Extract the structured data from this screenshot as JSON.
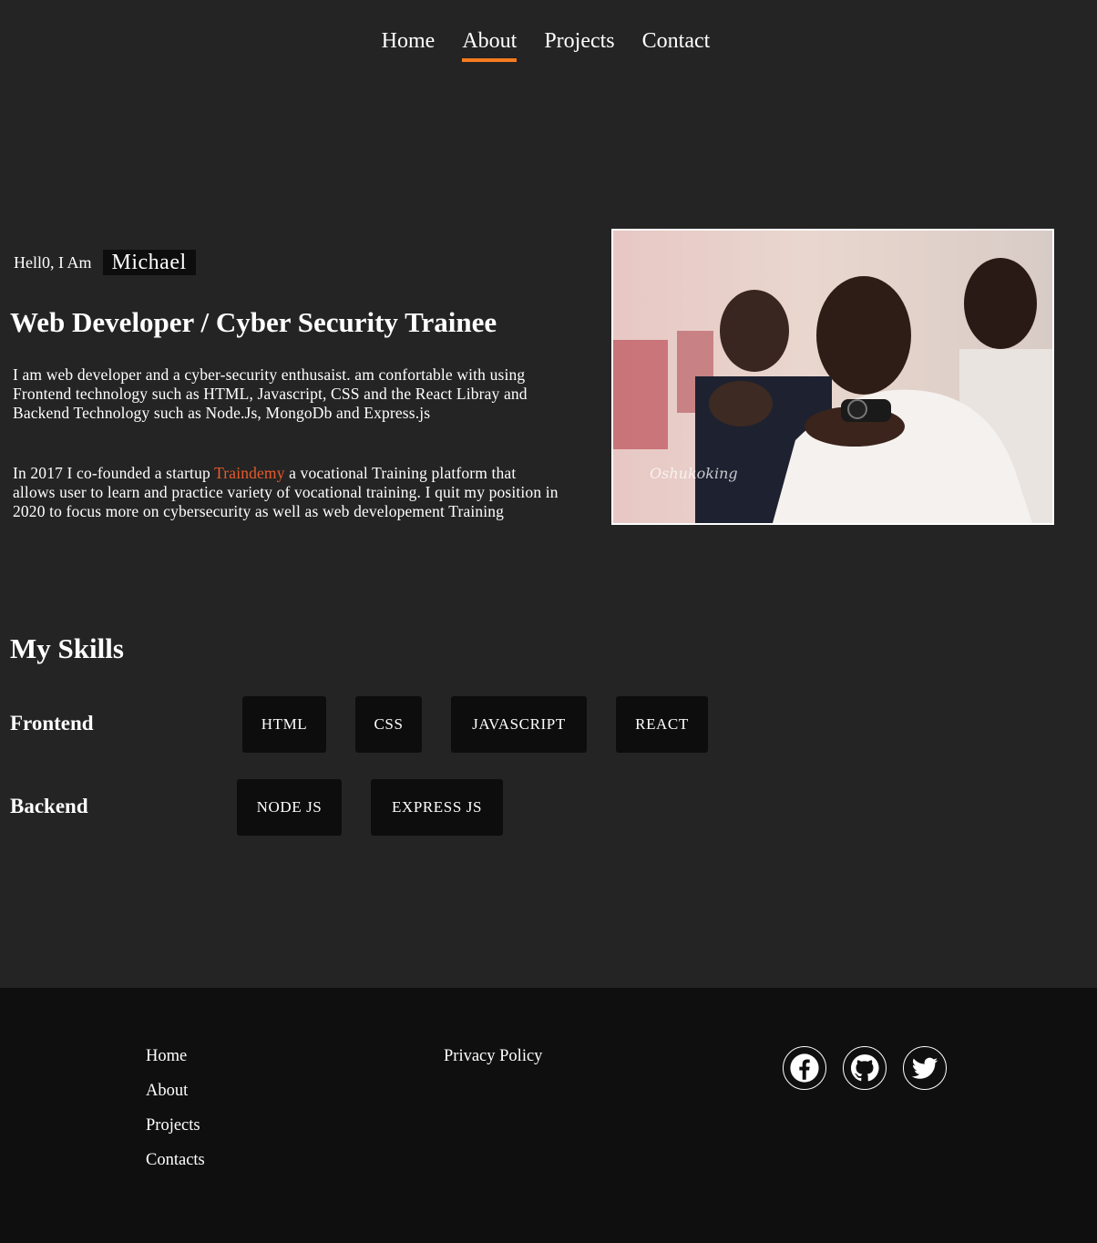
{
  "nav": {
    "items": [
      {
        "label": "Home"
      },
      {
        "label": "About"
      },
      {
        "label": "Projects"
      },
      {
        "label": "Contact"
      }
    ],
    "active": "About",
    "accent_color": "#f57c1f"
  },
  "hero": {
    "greeting": "Hell0, I Am",
    "name": "Michael",
    "title": "Web Developer / Cyber Security Trainee",
    "para1": "I am web developer and a cyber-security enthusaist. am confortable with using Frontend technology such as HTML, Javascript, CSS and the React Libray and Backend Technology such as Node.Js, MongoDb and Express.js",
    "para2_before": "In 2017 I co-founded a startup ",
    "para2_link": "Traindemy",
    "para2_after": " a vocational Training platform that allows user to learn and practice variety of vocational training. I quit my position in 2020 to focus more on cybersecurity as well as web developement Training",
    "link_color": "#e85a2c",
    "photo_watermark": "Oshukoking"
  },
  "skills": {
    "title": "My Skills",
    "frontend_label": "Frontend",
    "frontend": [
      "HTML",
      "CSS",
      "JAVASCRIPT",
      "REACT"
    ],
    "backend_label": "Backend",
    "backend": [
      "NODE JS",
      "EXPRESS JS"
    ]
  },
  "footer": {
    "links": [
      "Home",
      "About",
      "Projects",
      "Contacts"
    ],
    "privacy": "Privacy Policy",
    "social_icons": [
      "facebook-icon",
      "github-icon",
      "twitter-icon"
    ]
  }
}
